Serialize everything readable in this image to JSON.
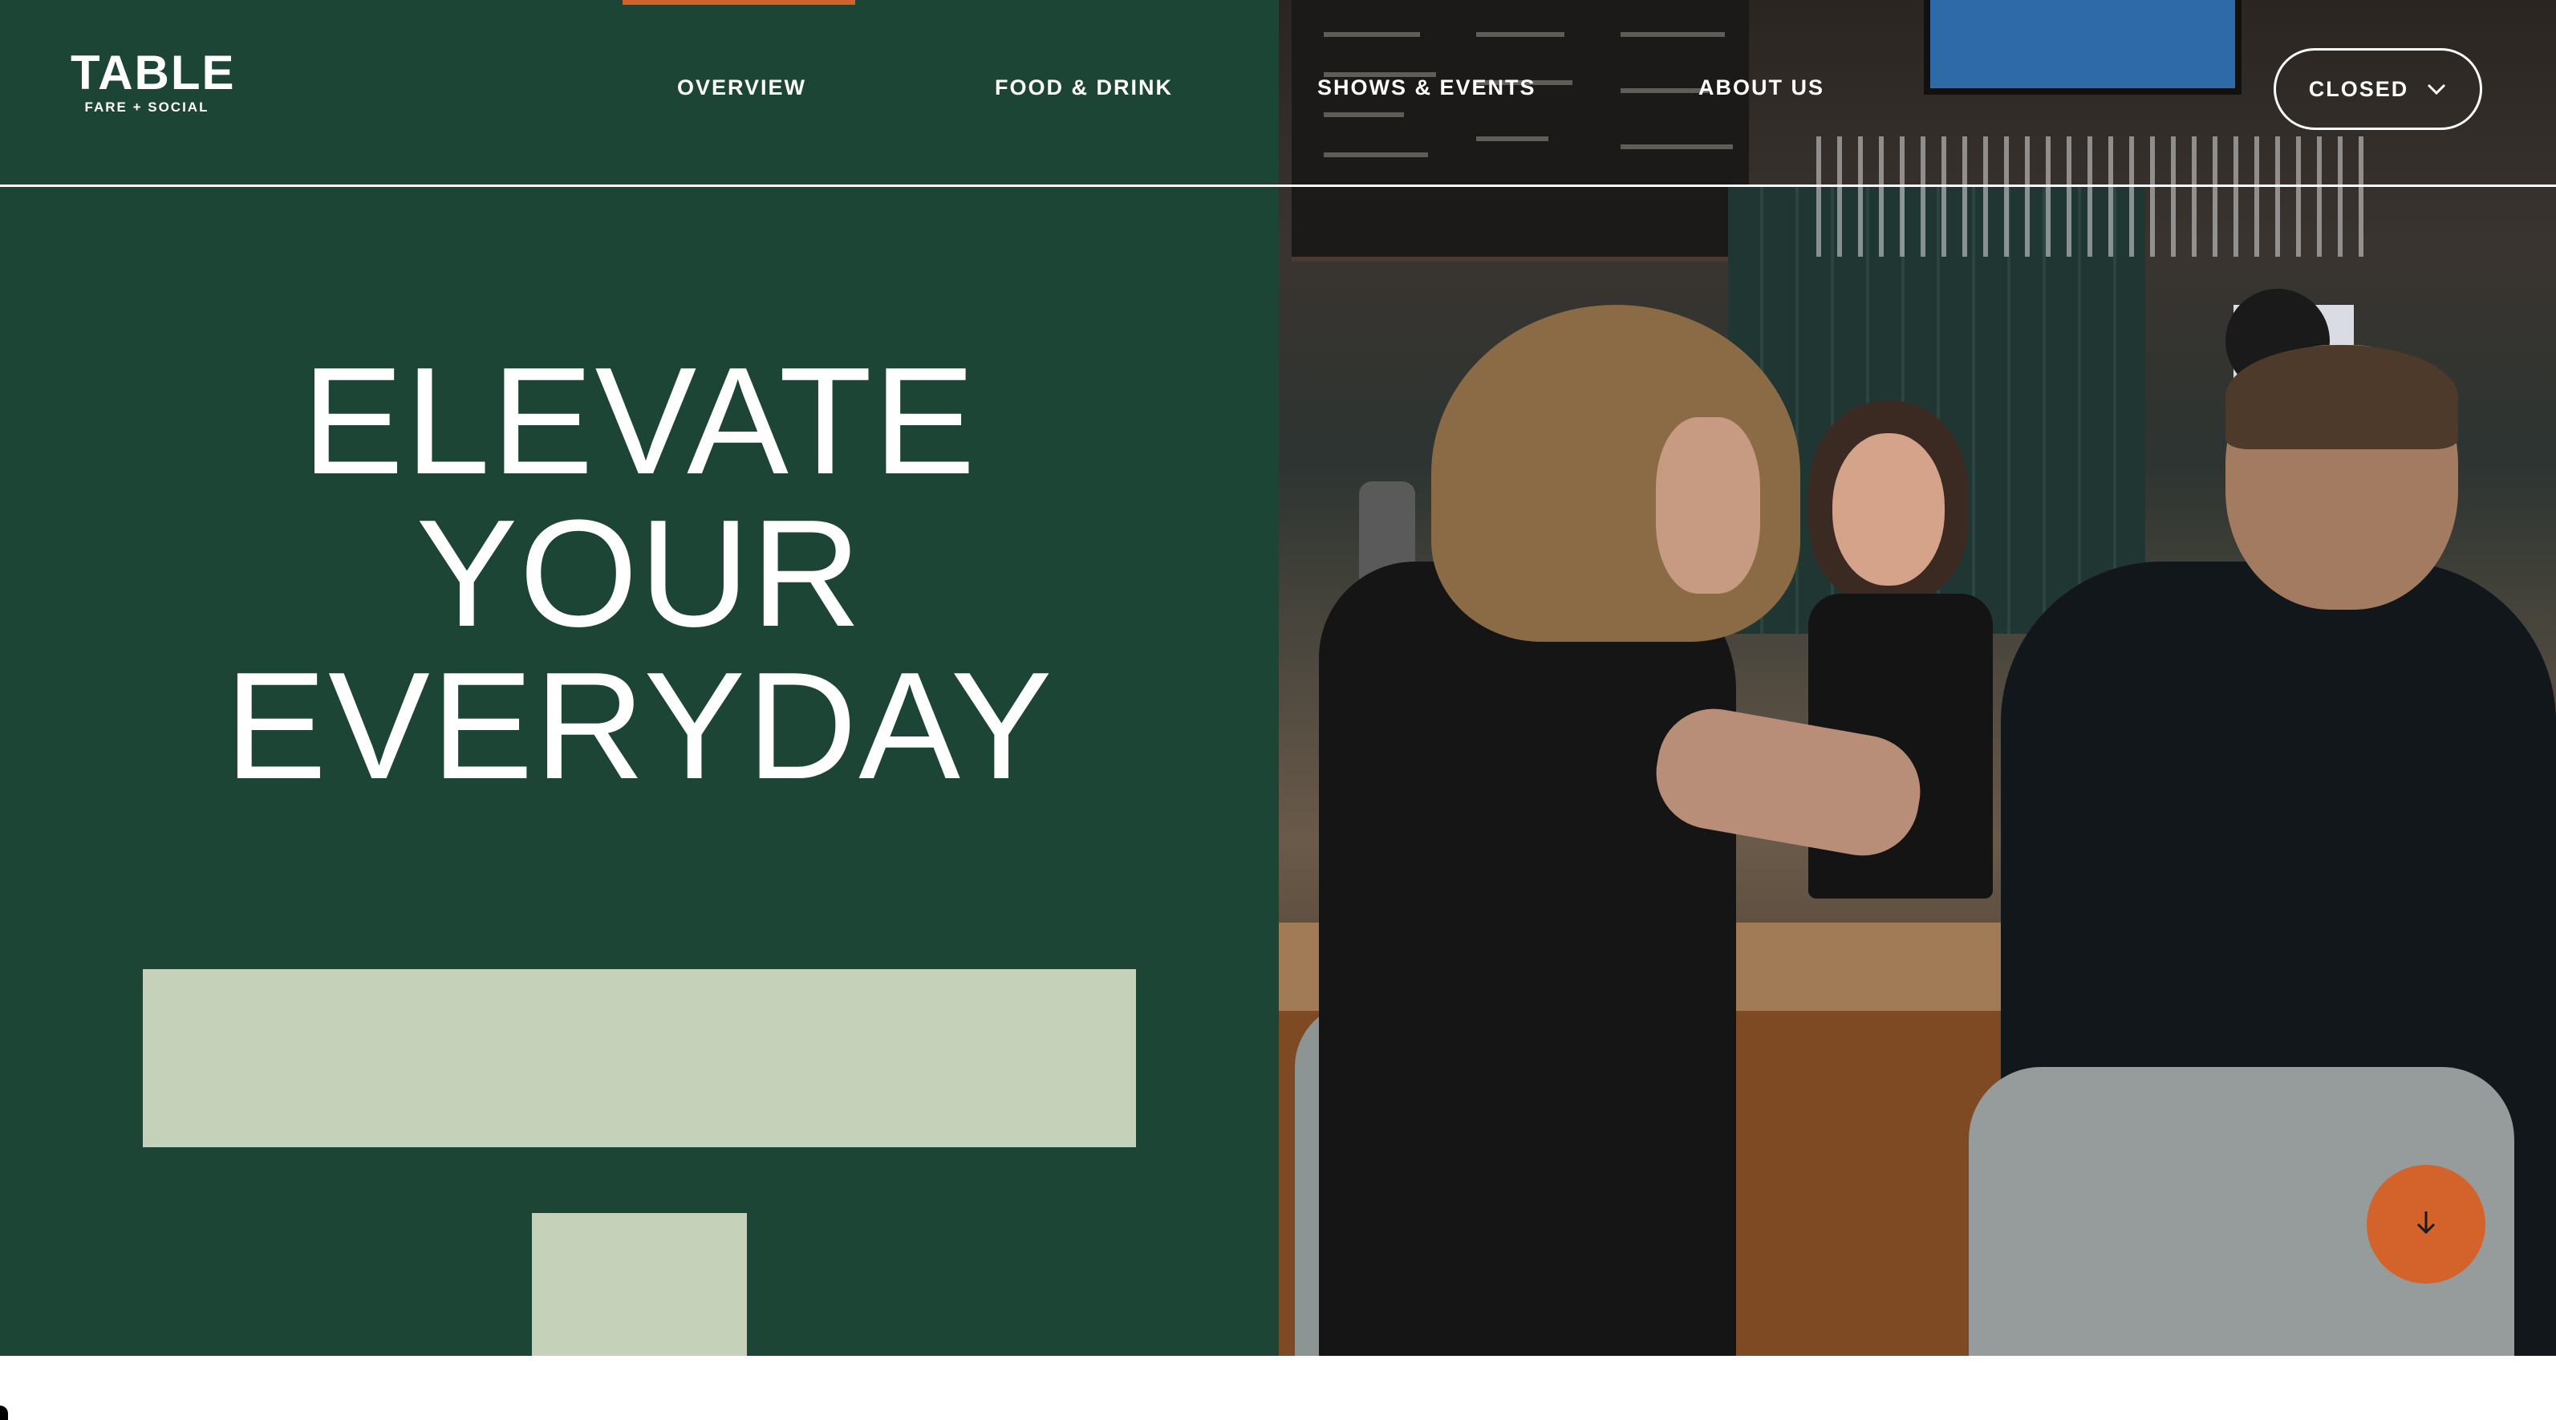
{
  "logo": {
    "title": "TABLE",
    "subtitle": "FARE + SOCIAL"
  },
  "nav": {
    "items": [
      {
        "label": "OVERVIEW",
        "active": true
      },
      {
        "label": "FOOD & DRINK",
        "active": false
      },
      {
        "label": "SHOWS & EVENTS",
        "active": false
      },
      {
        "label": "ABOUT US",
        "active": false
      }
    ]
  },
  "status": {
    "label": "CLOSED",
    "icon": "chevron-down-icon"
  },
  "hero": {
    "headline_lines": [
      "ELEVATE",
      "YOUR",
      "EVERYDAY"
    ],
    "image_alt": "Guests chatting with a smiling bartender at the bar counter"
  },
  "scroll_button": {
    "icon": "arrow-down-icon"
  },
  "colors": {
    "panel_green": "#1d4535",
    "accent_orange": "#d4622b",
    "sage_block": "#c6d1ba",
    "text_white": "#ffffff"
  }
}
